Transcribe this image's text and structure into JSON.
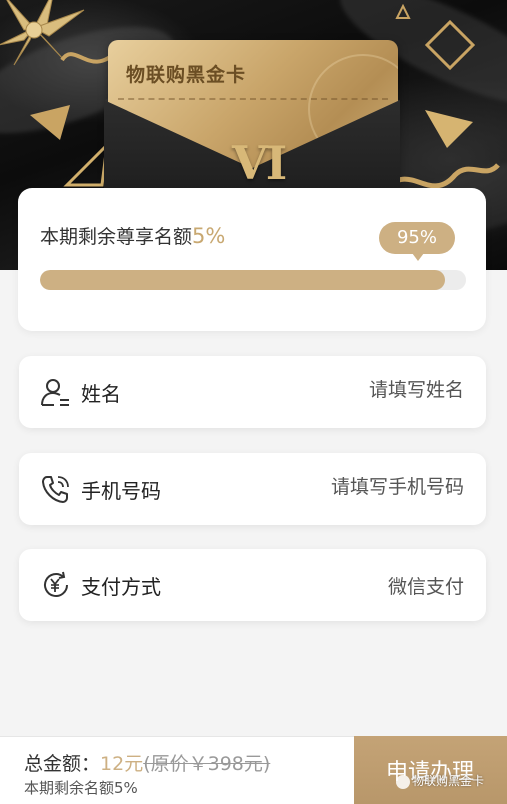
{
  "hero": {
    "card_title": "物联购黑金卡",
    "vip_text": "VI"
  },
  "quota": {
    "label": "本期剩余尊享名额",
    "remaining_percent_text": "5%",
    "progress_bubble": "95%",
    "progress_fraction": 0.95
  },
  "form": {
    "name": {
      "label": "姓名",
      "placeholder": "请填写姓名",
      "icon": "user-icon"
    },
    "phone": {
      "label": "手机号码",
      "placeholder": "请填写手机号码",
      "icon": "phone-icon"
    },
    "payment": {
      "label": "支付方式",
      "value": "微信支付",
      "icon": "yuan-refresh-icon"
    }
  },
  "footer": {
    "total_label": "总金额：",
    "price": "12元",
    "original_price": "(原价￥398元)",
    "remaining_note": "本期剩余名额5%",
    "apply_button": "申请办理",
    "watermark": "物联购黑金卡"
  },
  "colors": {
    "gold": "#cdb083",
    "gold_text": "#c8a871",
    "button": "#bd9c6f"
  }
}
